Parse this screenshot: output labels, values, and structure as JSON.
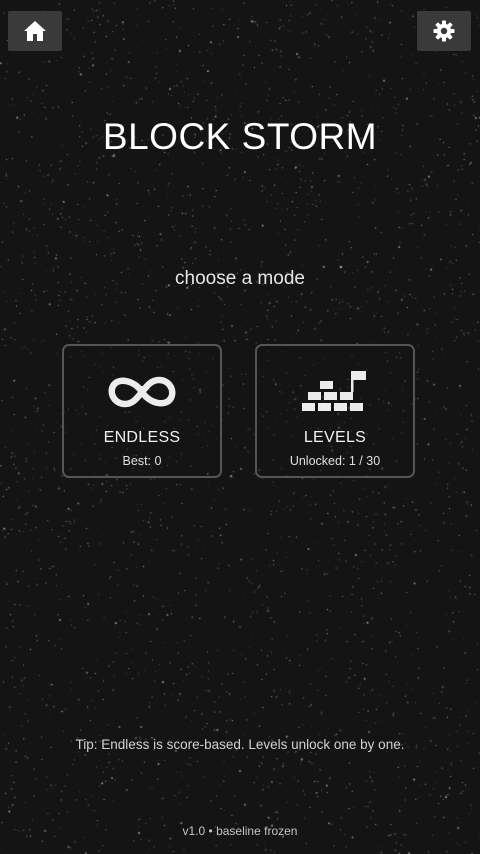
{
  "app": {
    "title": "BLOCK STORM",
    "subtitle": "choose a mode"
  },
  "topbar": {
    "home_icon": "home-icon",
    "settings_icon": "gear-icon"
  },
  "modes": [
    {
      "label": "ENDLESS",
      "stat": "Best: 0",
      "icon": "infinity-icon"
    },
    {
      "label": "LEVELS",
      "stat": "Unlocked: 1 / 30",
      "icon": "brick-wall-flag-icon"
    }
  ],
  "footer": {
    "tip": "Tip: Endless is score-based. Levels unlock one by one.",
    "version": "v1.0 • baseline frozen"
  },
  "colors": {
    "background": "#141414",
    "button_bg": "#3a3a3a",
    "card_border": "#555555",
    "text": "#f0f0f0"
  }
}
